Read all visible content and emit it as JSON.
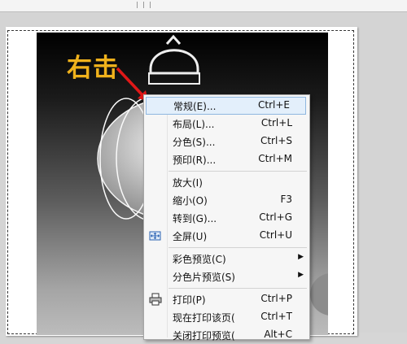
{
  "annotation": {
    "text": "右击",
    "color": "#f0b21c"
  },
  "context_menu": {
    "items": [
      {
        "label": "常规(E)...",
        "shortcut": "Ctrl+E",
        "highlighted": true
      },
      {
        "label": "布局(L)...",
        "shortcut": "Ctrl+L"
      },
      {
        "label": "分色(S)...",
        "shortcut": "Ctrl+S"
      },
      {
        "label": "预印(R)...",
        "shortcut": "Ctrl+M"
      },
      {
        "label": "放大(I)",
        "shortcut": ""
      },
      {
        "label": "缩小(O)",
        "shortcut": "F3"
      },
      {
        "label": "转到(G)...",
        "shortcut": "Ctrl+G"
      },
      {
        "label": "全屏(U)",
        "shortcut": "Ctrl+U",
        "icon": "fullscreen-icon"
      },
      {
        "label": "彩色预览(C)",
        "submenu": true
      },
      {
        "label": "分色片预览(S)",
        "submenu": true
      },
      {
        "label": "打印(P)",
        "shortcut": "Ctrl+P",
        "icon": "printer-icon"
      },
      {
        "label": "现在打印该页(",
        "shortcut": "Ctrl+T"
      },
      {
        "label": "关闭打印预览(",
        "shortcut": "Alt+C"
      }
    ]
  }
}
